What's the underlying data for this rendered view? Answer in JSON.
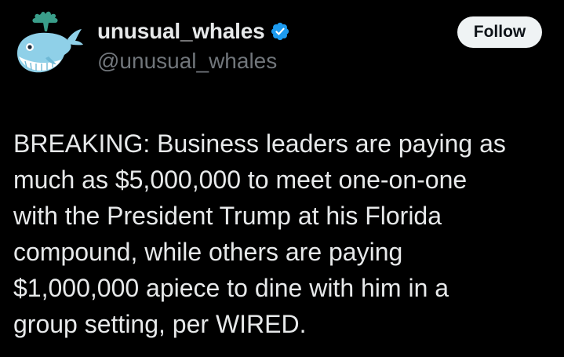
{
  "author": {
    "display_name": "unusual_whales",
    "handle": "@unusual_whales",
    "verified": true,
    "avatar_icon": "whale-logo-icon",
    "verified_icon": "verified-badge-icon"
  },
  "actions": {
    "follow_label": "Follow"
  },
  "tweet": {
    "lines": [
      "BREAKING: Business leaders are paying as",
      "much as $5,000,000 to meet one-on-one",
      "with the President Trump at his Florida",
      "compound, while others are paying",
      "$1,000,000 apiece to dine with him in a",
      "group setting, per WIRED."
    ]
  },
  "colors": {
    "background": "#000000",
    "text_primary": "#e7e9ea",
    "text_secondary": "#71767b",
    "verified_blue": "#1d9bf0",
    "follow_button_bg": "#eff3f4",
    "avatar_whale": "#8fd0e8",
    "avatar_spout": "#3a9e8a"
  }
}
